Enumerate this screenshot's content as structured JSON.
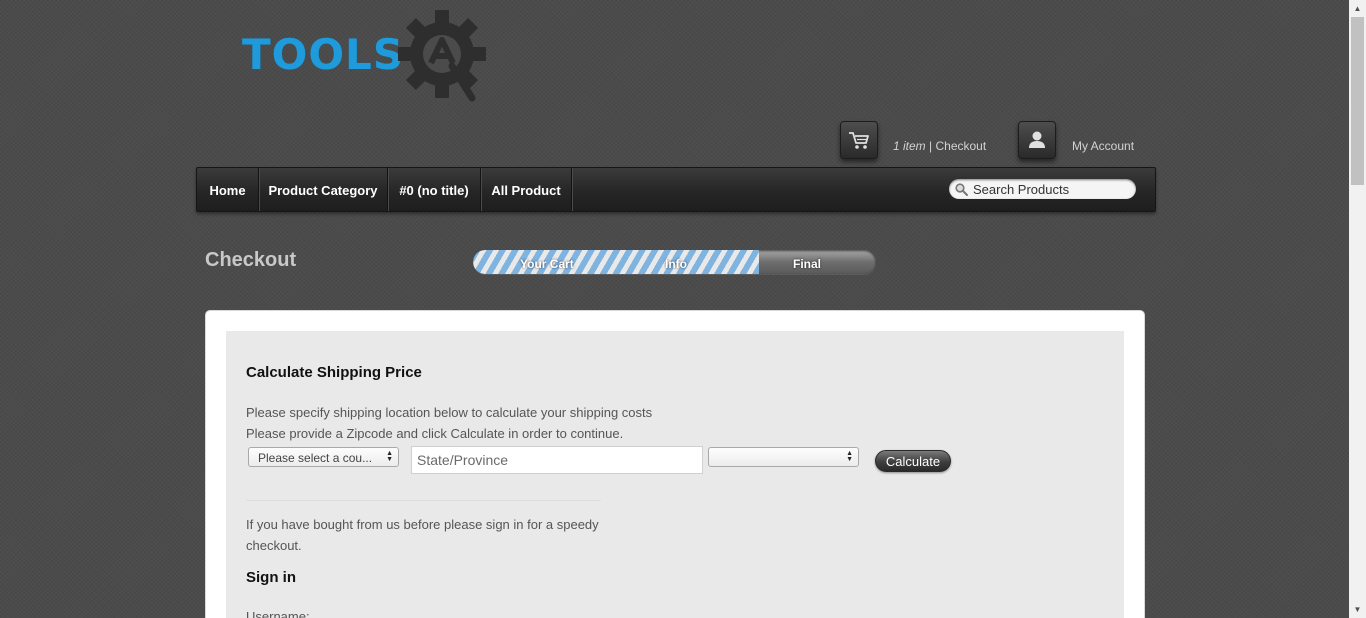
{
  "logo": {
    "text": "TOOLS"
  },
  "header": {
    "cart_count": "1 item",
    "cart_separator": " | ",
    "cart_link": "Checkout",
    "account_link": "My Account"
  },
  "nav": {
    "items": [
      {
        "label": "Home"
      },
      {
        "label": "Product Category"
      },
      {
        "label": "#0 (no title)"
      },
      {
        "label": "All Product"
      }
    ],
    "search_placeholder": "Search Products"
  },
  "checkout": {
    "title": "Checkout",
    "progress": {
      "steps": [
        "Your Cart",
        "Info",
        "Final"
      ],
      "completed_fraction": 0.71
    }
  },
  "shipping": {
    "title": "Calculate Shipping Price",
    "line1": "Please specify shipping location below to calculate your shipping costs",
    "line2": "Please provide a Zipcode and click Calculate in order to continue.",
    "country_select": "Please select a cou...",
    "state_placeholder": "State/Province",
    "third_select": "",
    "calculate_label": "Calculate"
  },
  "signin": {
    "intro": "If you have bought from us before please sign in for a speedy checkout.",
    "title": "Sign in",
    "username_label": "Username:"
  },
  "colors": {
    "brand_blue": "#1f9bdc",
    "page_bg": "#4b4b4b",
    "progress_stripe": "#7fb3e0"
  },
  "icons": {
    "logo": "gear-icon",
    "cart": "cart-icon",
    "account": "user-icon",
    "search": "search-icon"
  }
}
